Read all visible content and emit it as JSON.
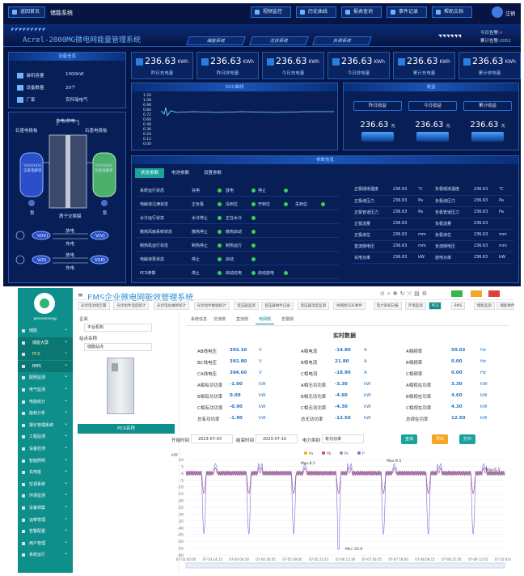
{
  "scada": {
    "toolbar": {
      "home": "返回首页",
      "system": "储能系统",
      "video": "视频监控",
      "history": "历史曲线",
      "report": "报表查询",
      "events": "事件记录",
      "help": "帮助文档",
      "logout": "注销"
    },
    "title": "Acrel-2000MG微电网能量管理系统",
    "nav": [
      "储能系统",
      "光伏系统",
      "负荷系统"
    ],
    "today_alarm_label": "今日告警:",
    "today_alarm": "4",
    "total_alarm_label": "累计告警:",
    "total_alarm": "2051",
    "device_info": {
      "title": "设备信息",
      "rows": [
        {
          "k": "装机容量",
          "v": "1000kW"
        },
        {
          "k": "设备数量",
          "v": "20个"
        },
        {
          "k": "厂家",
          "v": "安科瑞电气"
        }
      ]
    },
    "cards": [
      {
        "v": "236.63",
        "u": "KWh",
        "l": "昨日充电量"
      },
      {
        "v": "236.63",
        "u": "KWh",
        "l": "昨日放电量"
      },
      {
        "v": "236.63",
        "u": "KWh",
        "l": "今日充电量"
      },
      {
        "v": "236.63",
        "u": "KWh",
        "l": "今日放电量"
      },
      {
        "v": "236.63",
        "u": "KWh",
        "l": "累计充电量"
      },
      {
        "v": "236.63",
        "u": "KWh",
        "l": "累计放电量"
      }
    ],
    "soc": {
      "title": "SOC曲线",
      "y_ticks": [
        "1.20",
        "1.08",
        "0.96",
        "0.84",
        "0.72",
        "0.60",
        "0.48",
        "0.36",
        "0.24",
        "0.12",
        "0.00"
      ]
    },
    "income": {
      "title": "收益",
      "items": [
        {
          "t": "昨日收益",
          "v": "236.63",
          "u": "元"
        },
        {
          "t": "今日收益",
          "v": "236.63",
          "u": "元"
        },
        {
          "t": "累计收益",
          "v": "236.63",
          "u": "元"
        }
      ]
    },
    "diagram": {
      "charge_discharge": "充电/放电",
      "left_label": "石墨电极板",
      "right_label": "石墨电极板",
      "left_tank": "V(IV)/V(V)\n正极电解液",
      "right_tank": "V(II)/V(III)\n负极电解液",
      "pump1": "泵",
      "pump2": "泵",
      "membrane": "质子交换膜",
      "pos": "V(IV)",
      "pos2": "V(V)",
      "neg": "V(II)",
      "neg2": "V(III)",
      "discharge": "放电",
      "charge": "充电"
    },
    "params": {
      "title": "参数信息",
      "tabs": [
        "状态参数",
        "电池参数",
        "设置参数"
      ],
      "status_rows": [
        [
          "系统运行状态",
          "充电",
          "放电",
          "停止"
        ],
        [
          "电解液注满状态",
          "正负极",
          "没到位",
          "开到位",
          "关到位"
        ],
        [
          "水冷运行状态",
          "水冷停止",
          "正在水冷"
        ],
        [
          "散热风扇系统状态",
          "散热停止",
          "散热启动"
        ],
        [
          "制热机运行状态",
          "制热停止",
          "制热运行"
        ],
        [
          "电解液泵状态",
          "停止",
          "启动"
        ],
        [
          "PCS参数",
          "停止",
          "启动充电",
          "启动放电"
        ]
      ],
      "right_rows": [
        [
          "正极储液温度",
          "236.63",
          "℃",
          "负极储液温度",
          "236.63",
          "℃"
        ],
        [
          "正极液压力",
          "236.63",
          "Pa",
          "负极液压力",
          "236.63",
          "Pa"
        ],
        [
          "正极管道压力",
          "236.63",
          "Pa",
          "负极管道压力",
          "236.63",
          "Pa"
        ],
        [
          "正极流量",
          "236.63",
          "",
          "负极流量",
          "236.63",
          ""
        ],
        [
          "正极液位",
          "236.63",
          "mm",
          "负极液位",
          "236.63",
          "mm"
        ],
        [
          "直流侧电压",
          "236.63",
          "mm",
          "负流侧电压",
          "236.63",
          "mm"
        ],
        [
          "充电功率",
          "236.63",
          "kW",
          "放电功率",
          "236.63",
          "kW"
        ]
      ]
    }
  },
  "ems": {
    "title": "EMS企业微电网能效管理系统",
    "brand": "greenenergy",
    "sidebar": [
      "储能",
      "储能大屏",
      "PCS",
      "BMS",
      "配网监测",
      "电气监测",
      "电能统计",
      "能耗分析",
      "报价管理系统",
      "工程监测",
      "设备检测",
      "智能照明",
      "充电桩",
      "空调系统",
      "环境监测",
      "设备档案",
      "运维管理",
      "告警配置",
      "用户管理",
      "系统运行"
    ],
    "tabs": [
      "光伏电池组告警",
      "光伏组件温度统计",
      "光伏电站维修统计",
      "光伏组件数据统计",
      "变压器监测",
      "变压器事件记录",
      "变压器温度监测",
      "并网柜SOE事件",
      "电力系统日报",
      "环境监测",
      "PCS",
      "BMS",
      "储能监测",
      "储能事件",
      "便携分析"
    ],
    "left": {
      "enterprise_label": "企业",
      "enterprise": "平台机构",
      "site_label": "站点名称",
      "site": "储能站点",
      "device": "PCS名称"
    },
    "content_tabs": [
      "系统信息",
      "交流侧",
      "直流侧",
      "电网侧",
      "告警侧"
    ],
    "realtime_title": "实时数据",
    "rt_rows": [
      [
        "AB线电压",
        "393.10",
        "V",
        "A相电流",
        "-14.80",
        "A",
        "A相频率",
        "50.02",
        "Hz"
      ],
      [
        "BC线电压",
        "392.80",
        "V",
        "B相电流",
        "21.80",
        "A",
        "B相频率",
        "0.00",
        "Hz"
      ],
      [
        "CA线电压",
        "394.60",
        "V",
        "C相电流",
        "-18.90",
        "A",
        "C相频率",
        "0.00",
        "Hz"
      ],
      [
        "A相有功功率",
        "-1.00",
        "kW",
        "A相无功功率",
        "-3.30",
        "kW",
        "A相视在功率",
        "3.30",
        "kW"
      ],
      [
        "B相有功功率",
        "0.00",
        "kW",
        "B相无功功率",
        "-4.60",
        "kW",
        "B相视在功率",
        "4.60",
        "kW"
      ],
      [
        "C相有功功率",
        "-0.90",
        "kW",
        "C相无功功率",
        "-4.30",
        "kW",
        "C相视在功率",
        "4.30",
        "kW"
      ],
      [
        "总有功功率",
        "-1.90",
        "kW",
        "总无功功率",
        "-12.50",
        "kW",
        "总视在功率",
        "12.50",
        "kW"
      ]
    ],
    "filter": {
      "start_label": "开始时间",
      "start": "2023-07-03",
      "end_label": "结束时间",
      "end": "2023-07-10",
      "type_label": "电力类别",
      "type": "有功功率",
      "query": "查询",
      "export": "导出",
      "print": "打印"
    }
  },
  "chart_data": {
    "type": "line",
    "ylabel": "kW",
    "series": [
      {
        "name": "Pa",
        "color": "#f5a623"
      },
      {
        "name": "Pb",
        "color": "#e0413e"
      },
      {
        "name": "Pc",
        "color": "#9b7fd4"
      },
      {
        "name": "P",
        "color": "#7b6fd8"
      }
    ],
    "y_ticks": [
      "10",
      "5",
      "0",
      "-5",
      "-10",
      "-15",
      "-20",
      "-25",
      "-30",
      "-35",
      "-40",
      "-45",
      "-50",
      "-55",
      "-60"
    ],
    "x_ticks": [
      "07-03 00:00",
      "07-03 14:15",
      "07-04 04:30",
      "07-04 18:45",
      "07-05 09:00",
      "07-05 23:15",
      "07-06 13:30",
      "07-07 03:45",
      "07-07 18:00",
      "07-08 08:15",
      "07-08 22:30",
      "07-09 12:45",
      "07-10 03:00"
    ],
    "annotations": [
      "Max:9.5",
      "Max:8.5",
      "Max:6.5",
      "Min:-55.9"
    ]
  }
}
